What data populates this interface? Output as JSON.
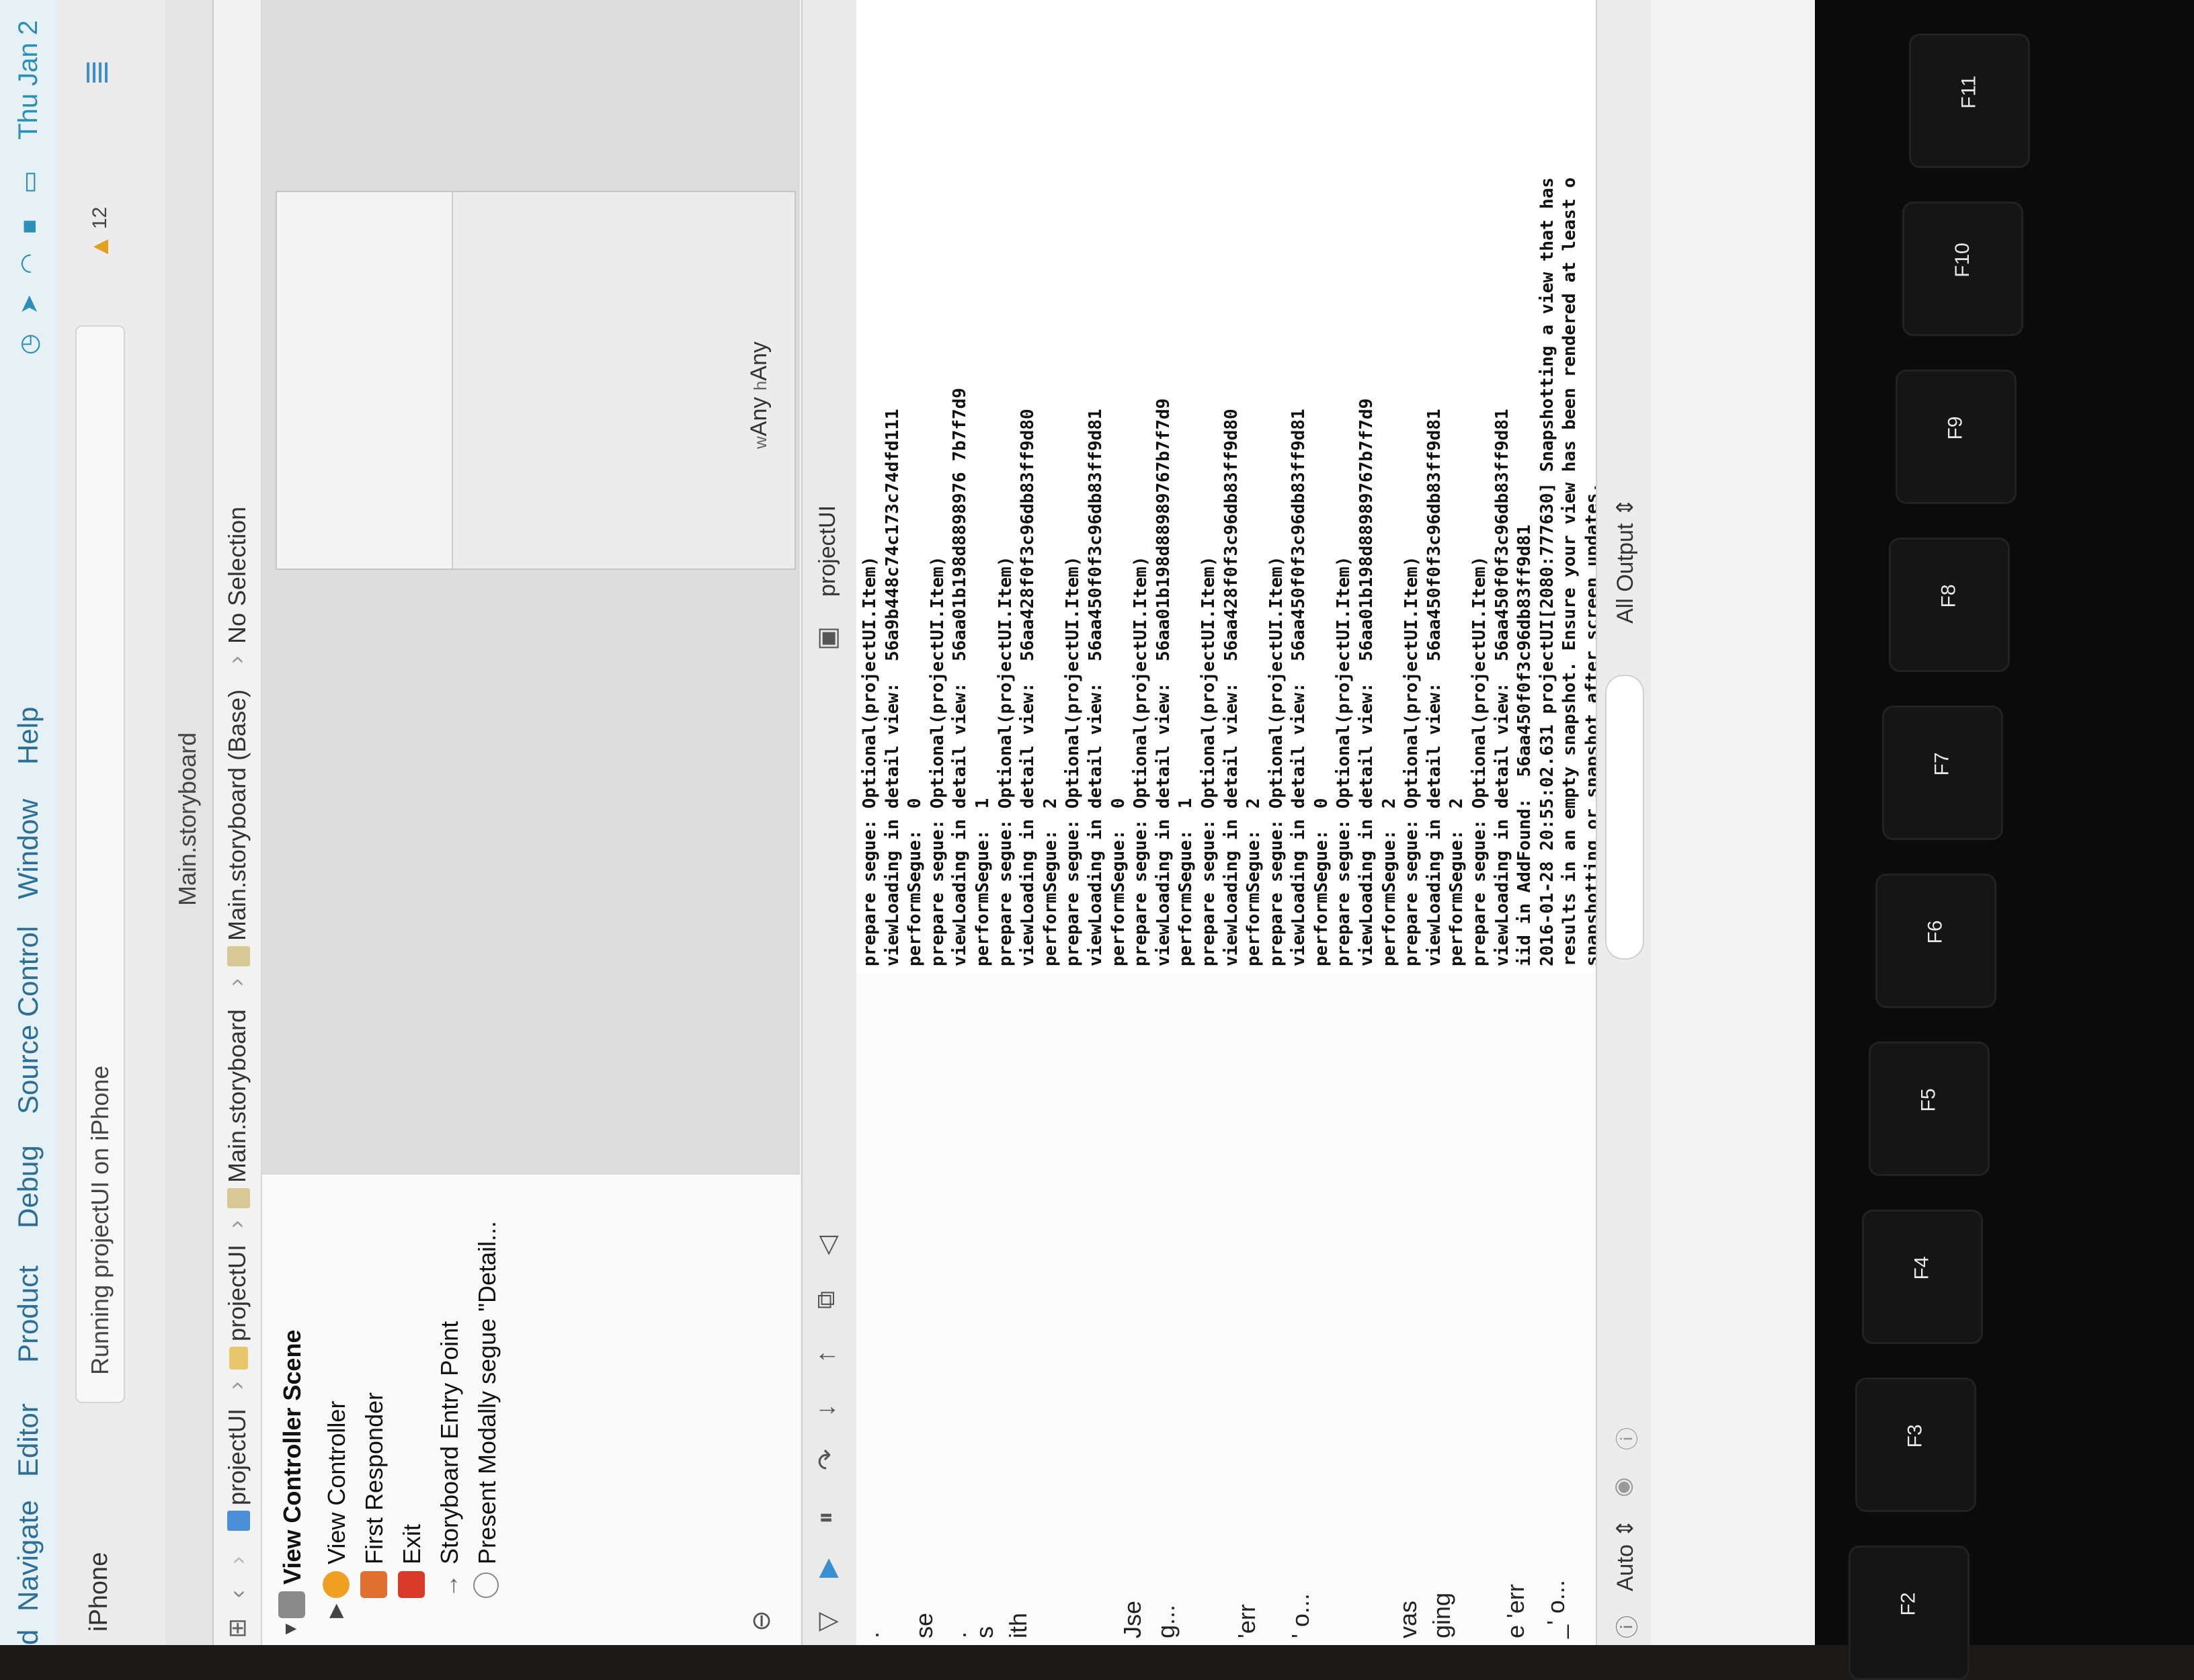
{
  "menubar": {
    "items": [
      "Navigate",
      "Editor",
      "Product",
      "Debug",
      "Source Control",
      "Window",
      "Help"
    ],
    "partial_left": "d",
    "clock": "Thu Jan 2"
  },
  "toolbar": {
    "device": "iPhone",
    "activity": "Running projectUI on iPhone",
    "warning_count": "12"
  },
  "tab": {
    "title": "Main.storyboard"
  },
  "jumpbar": {
    "items": [
      "projectUI",
      "projectUI",
      "Main.storyboard",
      "Main.storyboard (Base)",
      "No Selection"
    ]
  },
  "outline": {
    "scene": "View Controller Scene",
    "items": [
      "View Controller",
      "First Responder",
      "Exit",
      "Storyboard Entry Point",
      "Present Modally segue \"Detail..."
    ]
  },
  "canvas": {
    "size_w": "Any",
    "size_h": "Any",
    "w_prefix": "w",
    "h_prefix": "h"
  },
  "debug": {
    "app": "projectUI"
  },
  "vars_cut": [
    ".",
    "se",
    ".",
    "s",
    "ith",
    "Jse",
    "g...",
    "'err",
    "' o...",
    "vas",
    "ging",
    "e 'err",
    "_' o..."
  ],
  "console": {
    "lines": [
      "prepare segue: Optional(projectUI.Item)",
      "viewLoading in detail view:  56a9b448c74c173c74dfd111",
      "performSegue:  0",
      "prepare segue: Optional(projectUI.Item)",
      "viewLoading in detail view:  56aa01b198d8898976 7b7f7d9",
      "performSegue:  1",
      "prepare segue: Optional(projectUI.Item)",
      "viewLoading in detail view:  56aa428f0f3c96db83ff9d80",
      "performSegue:  2",
      "prepare segue: Optional(projectUI.Item)",
      "viewLoading in detail view:  56aa450f0f3c96db83ff9d81",
      "performSegue:  0",
      "prepare segue: Optional(projectUI.Item)",
      "viewLoading in detail view:  56aa01b198d88989767b7f7d9",
      "performSegue:  1",
      "prepare segue: Optional(projectUI.Item)",
      "viewLoading in detail view:  56aa428f0f3c96db83ff9d80",
      "performSegue:  2",
      "prepare segue: Optional(projectUI.Item)",
      "viewLoading in detail view:  56aa450f0f3c96db83ff9d81",
      "performSegue:  0",
      "prepare segue: Optional(projectUI.Item)",
      "viewLoading in detail view:  56aa01b198d88989767b7f7d9",
      "performSegue:  2",
      "prepare segue: Optional(projectUI.Item)",
      "viewLoading in detail view:  56aa450f0f3c96db83ff9d81",
      "performSegue:  2",
      "prepare segue: Optional(projectUI.Item)",
      "viewLoading in detail view:  56aa450f0f3c96db83ff9d81",
      "iid in AddFound:  56aa450f0f3c96db83ff9d81",
      "2016-01-28 20:55:02.631 projectUI[2080:777630] Snapshotting a view that has",
      "results in an empty snapshot. Ensure your view has been rendered at least o",
      "snapshotting or snapshot after screen updates."
    ]
  },
  "bottom": {
    "auto": "Auto",
    "output": "All Output"
  },
  "keys": [
    "F2",
    "F3",
    "F4",
    "F5",
    "F6",
    "F7",
    "F8",
    "F9",
    "F10",
    "F11"
  ],
  "colors": {
    "menu_text": "#2c6e98",
    "accent": "#3a8fd0",
    "warning": "#e0a020"
  }
}
